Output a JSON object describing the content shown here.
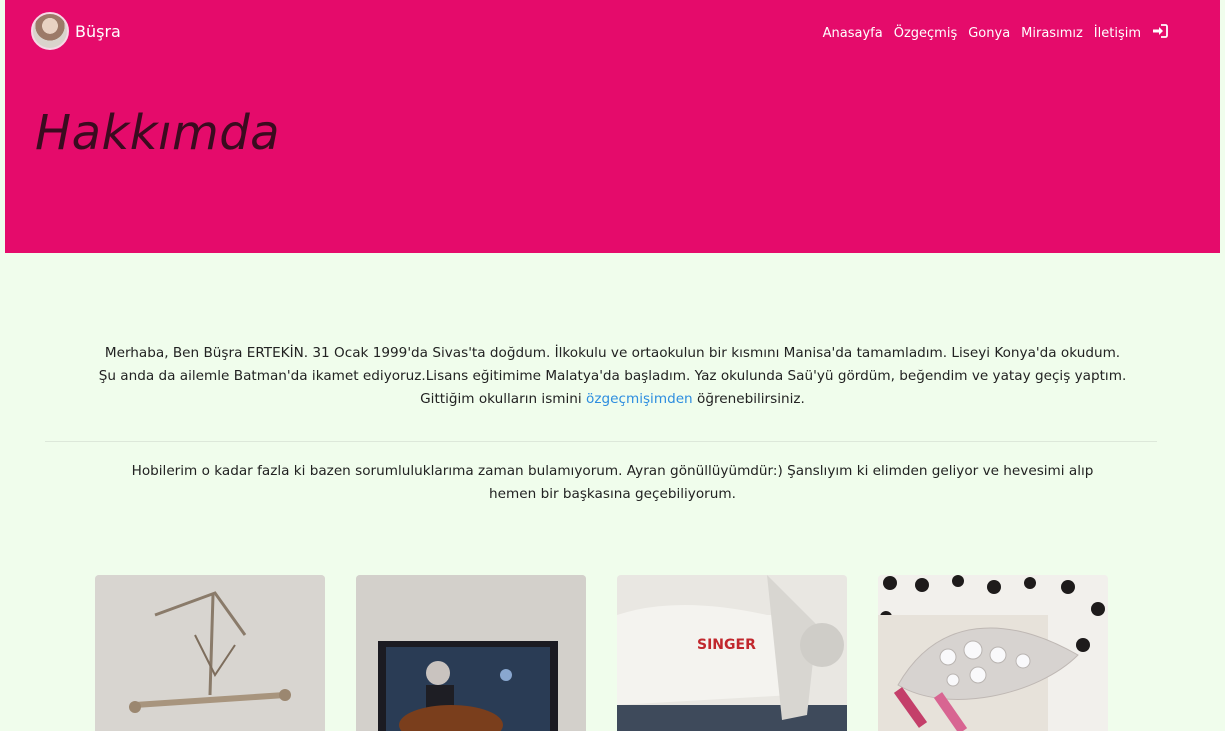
{
  "brand": {
    "name": "Büşra"
  },
  "nav": {
    "items": [
      {
        "label": "Anasayfa"
      },
      {
        "label": "Özgeçmiş"
      },
      {
        "label": "Gonya"
      },
      {
        "label": "Mirasımız"
      },
      {
        "label": "İletişim"
      }
    ],
    "login_icon": "sign-in-icon"
  },
  "hero": {
    "title": "Hakkımda"
  },
  "intro": {
    "line1": "Merhaba, Ben Büşra ERTEKİN. 31 Ocak 1999'da Sivas'ta doğdum. İlkokulu ve ortaokulun bir kısmını Manisa'da tamamladım. Liseyi Konya'da okudum.",
    "line2": "Şu anda da ailemle Batman'da ikamet ediyoruz.Lisans eğitimime Malatya'da başladım. Yaz okulunda Saü'yü gördüm, beğendim ve yatay geçiş yaptım.",
    "line3_before": "Gittiğim okulların ismini",
    "link": "özgeçmişimden",
    "line3_after": "öğrenebilirsiniz."
  },
  "hobby": {
    "line1": "Hobilerim o kadar fazla ki bazen sorumluluklarıma zaman bulamıyorum. Ayran gönüllüyümdür:) Şanslıyım ki elimden geliyor ve hevesimi alıp",
    "line2": "hemen bir başkasına geçebiliyorum."
  },
  "gallery": {
    "singer_label": "SINGER"
  },
  "colors": {
    "hero_bg": "#e50b6b",
    "page_bg": "#f0fdec",
    "link": "#2d8ddf"
  }
}
